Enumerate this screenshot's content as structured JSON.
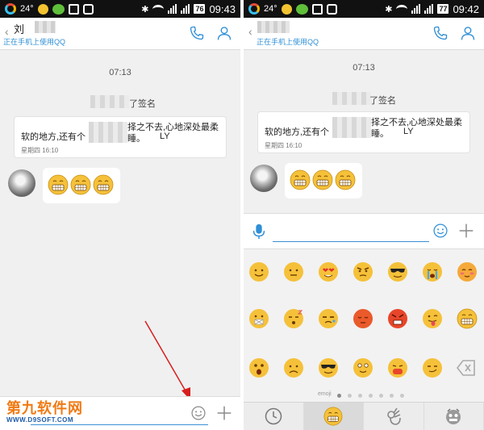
{
  "status_bar_left": {
    "temperature": "24°",
    "time": "09:43",
    "battery": "76"
  },
  "status_bar_right": {
    "temperature": "24°",
    "time": "09:42",
    "battery": "77"
  },
  "contact": {
    "name": "刘",
    "status": "正在手机上使用QQ"
  },
  "chat": {
    "timestamp": "07:13",
    "signature_notice_suffix": "了签名",
    "signature_notice_suffix_right": "了签名",
    "signature_line1": "择之不去,心地深处最柔",
    "signature_line2_start": "软的地方,还有个",
    "signature_line2_end": "睡。",
    "signature_sign": "LY",
    "signature_date": "星期四 16:10"
  },
  "emoji_panel": {
    "page_label": "emoji",
    "page_count": 7,
    "active_page": 0
  },
  "watermark": {
    "main": "第九软件网",
    "url": "WWW.D9SOFT.COM"
  },
  "icons": {
    "back": "back-chevron-icon",
    "call": "phone-icon",
    "profile": "profile-icon",
    "smile": "smile-icon",
    "plus": "plus-icon",
    "mic": "mic-icon",
    "delete": "backspace-icon",
    "recent": "clock-icon"
  },
  "colors": {
    "accent": "#2f8fd6",
    "emoji_yellow": "#f5c13a",
    "annotation": "#d81e1e"
  }
}
